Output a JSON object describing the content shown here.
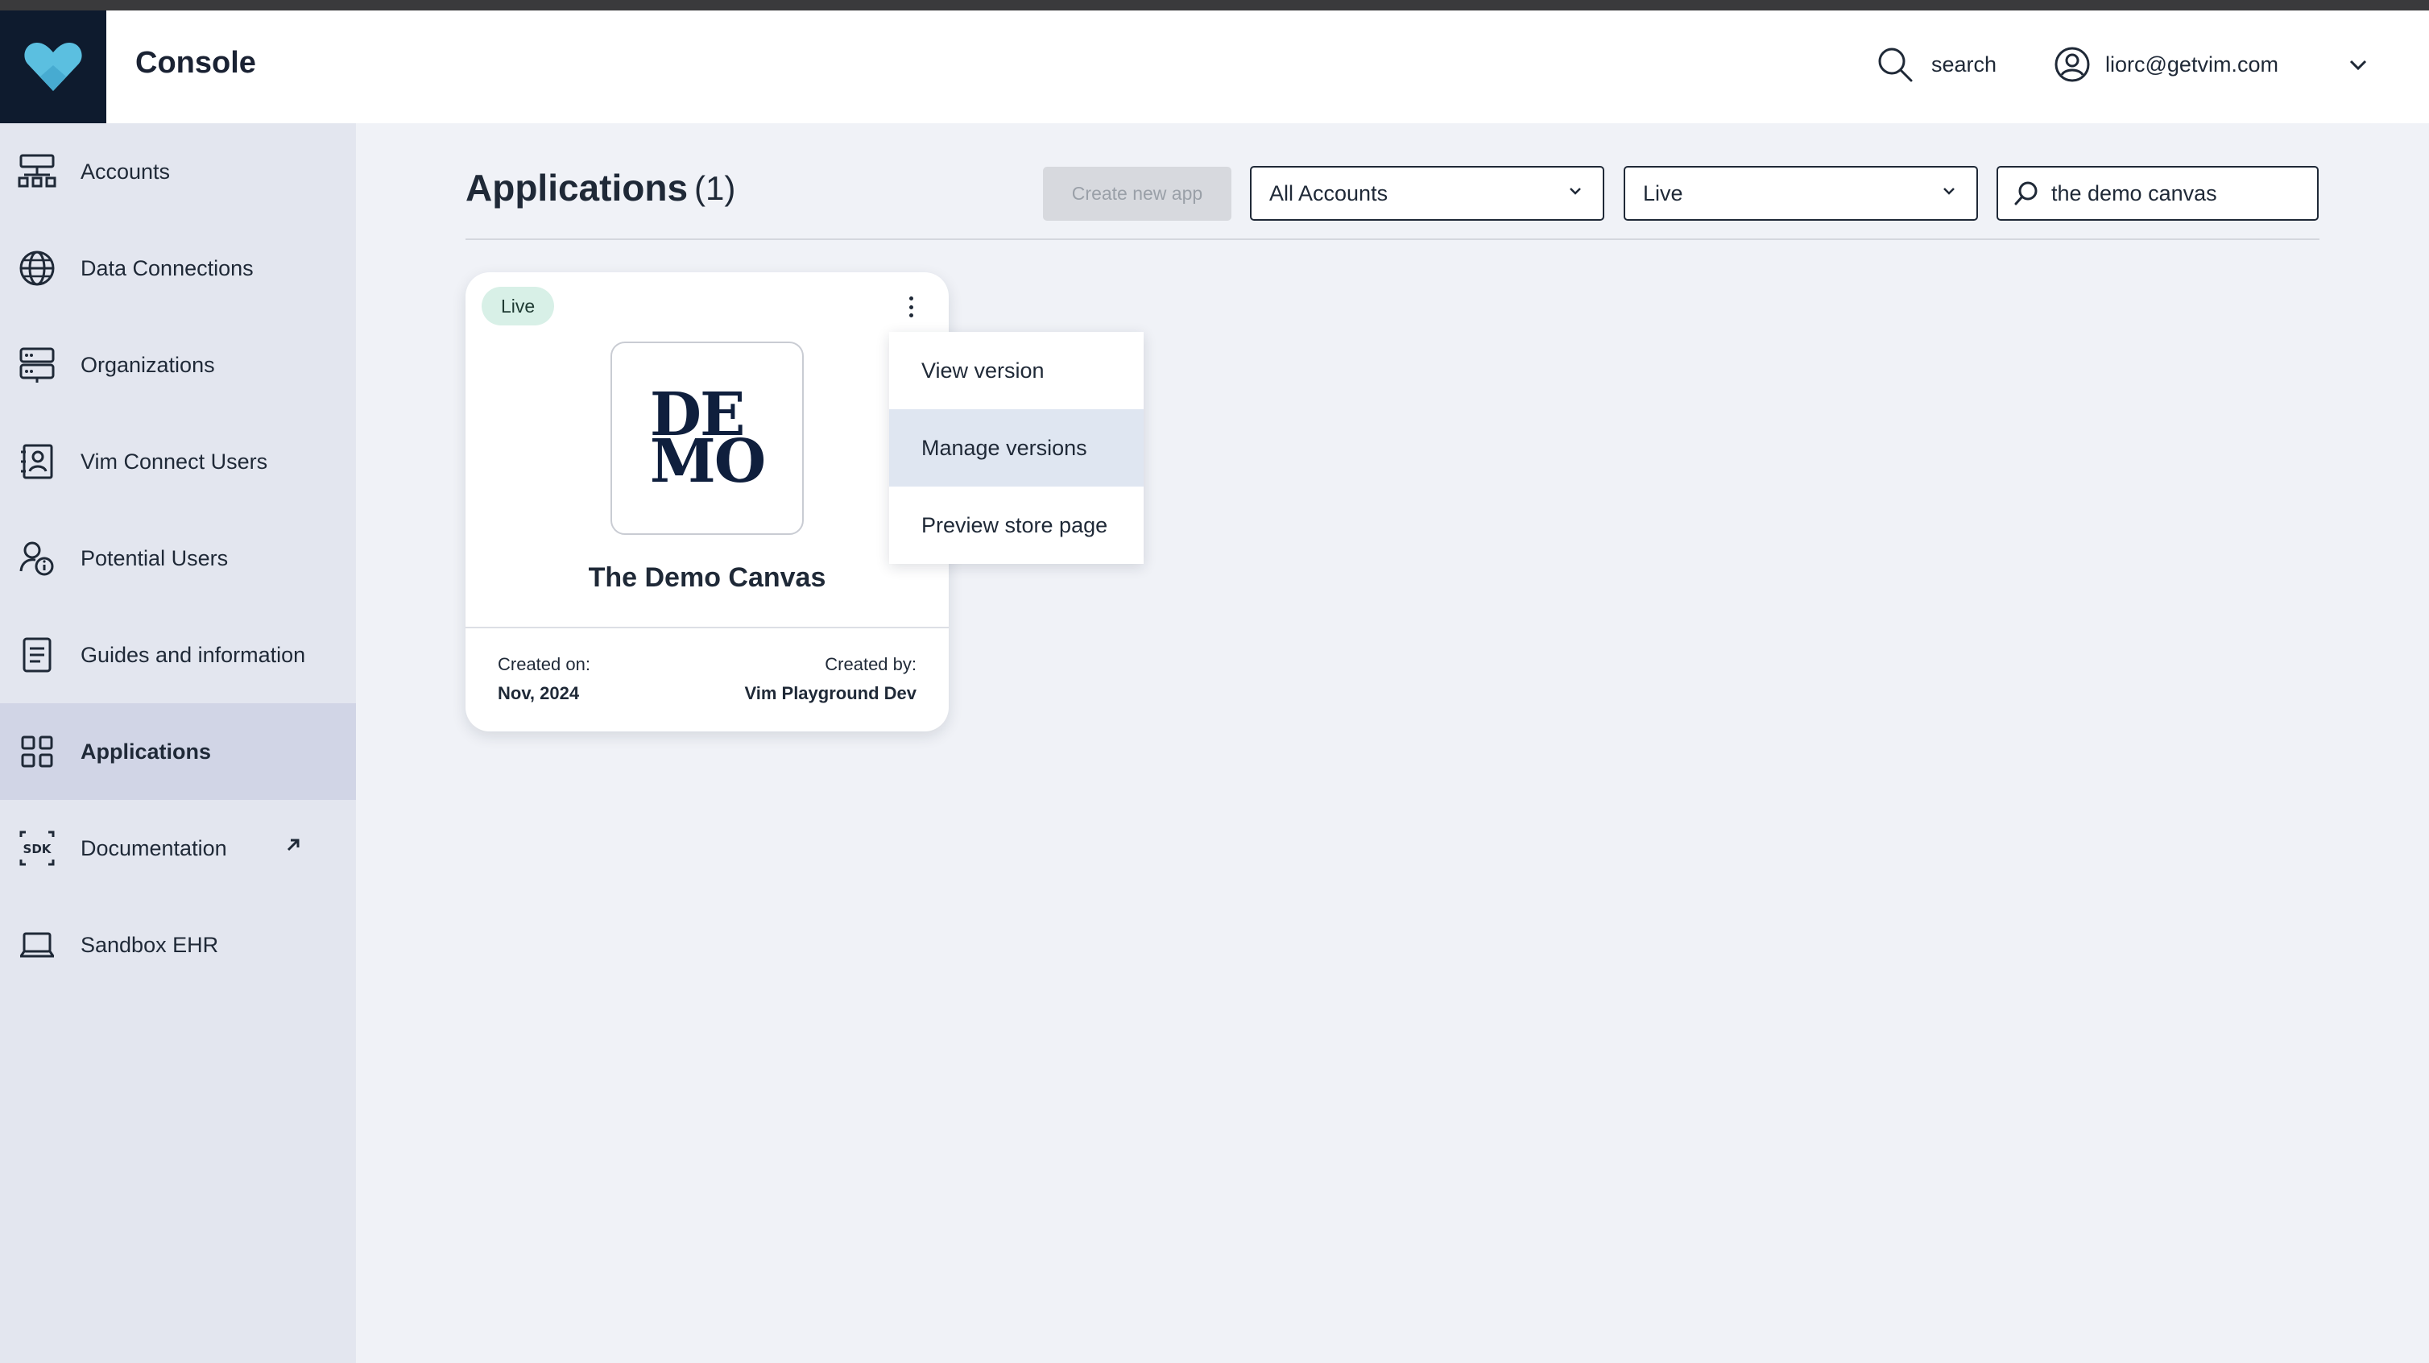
{
  "header": {
    "app_title": "Console",
    "search_label": "search",
    "user_email": "liorc@getvim.com"
  },
  "colors": {
    "sidebar_bg": "#e3e6ef",
    "active_nav_bg": "#d1d5e6",
    "logo_bg": "#0e1b2e",
    "logo_heart": "#5bbfe0",
    "badge_live_bg": "#d8f0e7",
    "menu_highlight": "#dfe6f1"
  },
  "sidebar": {
    "items": [
      {
        "label": "Accounts",
        "icon": "accounts-icon"
      },
      {
        "label": "Data Connections",
        "icon": "globe-icon"
      },
      {
        "label": "Organizations",
        "icon": "server-icon"
      },
      {
        "label": "Vim Connect Users",
        "icon": "contact-card-icon"
      },
      {
        "label": "Potential Users",
        "icon": "user-info-icon"
      },
      {
        "label": "Guides and information",
        "icon": "document-icon"
      },
      {
        "label": "Applications",
        "icon": "grid-icon",
        "active": true
      },
      {
        "label": "Documentation",
        "icon": "sdk-icon",
        "external": true
      },
      {
        "label": "Sandbox EHR",
        "icon": "laptop-icon"
      }
    ]
  },
  "main": {
    "title": "Applications",
    "count": "(1)",
    "create_button": "Create new app",
    "account_filter": "All Accounts",
    "status_filter": "Live",
    "search_value": "the demo canvas"
  },
  "card": {
    "status": "Live",
    "logo_line1": "DE",
    "logo_line2": "MO",
    "name": "The Demo Canvas",
    "created_on_label": "Created on:",
    "created_on": "Nov, 2024",
    "created_by_label": "Created by:",
    "created_by": "Vim Playground Dev"
  },
  "context_menu": {
    "items": [
      "View version",
      "Manage versions",
      "Preview store page"
    ],
    "highlighted": "Manage versions"
  }
}
